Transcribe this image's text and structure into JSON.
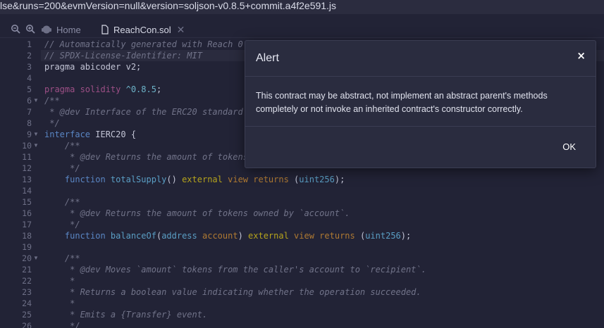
{
  "url_fragment": "lse&runs=200&evmVersion=null&version=soljson-v0.8.5+commit.a4f2e591.js",
  "toolbar": {
    "zoom_out_icon": "zoom-out-icon",
    "zoom_in_icon": "zoom-in-icon"
  },
  "tabs": [
    {
      "label": "Home",
      "icon": "remix-logo-icon",
      "active": false
    },
    {
      "label": "ReachCon.sol",
      "icon": "file-icon",
      "active": true,
      "close_icon": "close-icon"
    }
  ],
  "editor": {
    "line_numbers": [
      "1",
      "2",
      "3",
      "4",
      "5",
      "6",
      "7",
      "8",
      "9",
      "10",
      "11",
      "12",
      "13",
      "14",
      "15",
      "16",
      "17",
      "18",
      "19",
      "20",
      "21",
      "22",
      "23",
      "24",
      "25",
      "26"
    ],
    "fold_lines": [
      "6",
      "9",
      "10",
      "20"
    ],
    "line_1": "// Automatically generated with Reach 0",
    "line_2": "// SPDX-License-Identifier: MIT",
    "line_3": "pragma abicoder v2;",
    "line_5_a": "pragma solidity ",
    "line_5_b": "^0.8.5",
    "line_5_c": ";",
    "line_6": "/**",
    "line_7": " * @dev Interface of the ERC20 standard",
    "line_8": " */",
    "line_9_a": "interface",
    "line_9_b": " IERC20 {",
    "line_10": "    /**",
    "line_11": "     * @dev Returns the amount of tokens",
    "line_12": "     */",
    "line_13_a": "    function",
    "line_13_b": " totalSupply",
    "line_13_c": "()",
    "line_13_d": " external",
    "line_13_e": " view",
    "line_13_f": " returns",
    "line_13_g": " (",
    "line_13_h": "uint256",
    "line_13_i": ");",
    "line_15": "    /**",
    "line_16": "     * @dev Returns the amount of tokens owned by `account`.",
    "line_17": "     */",
    "line_18_a": "    function",
    "line_18_b": " balanceOf",
    "line_18_c": "(",
    "line_18_d": "address",
    "line_18_e": " account",
    "line_18_f": ")",
    "line_18_g": " external",
    "line_18_h": " view",
    "line_18_i": " returns",
    "line_18_j": " (",
    "line_18_k": "uint256",
    "line_18_l": ");",
    "line_20": "    /**",
    "line_21": "     * @dev Moves `amount` tokens from the caller's account to `recipient`.",
    "line_22": "     *",
    "line_23": "     * Returns a boolean value indicating whether the operation succeeded.",
    "line_24": "     *",
    "line_25": "     * Emits a {Transfer} event.",
    "line_26": "     */"
  },
  "alert": {
    "title": "Alert",
    "close_symbol": "×",
    "message": "This contract may be abstract, not implement an abstract parent's methods completely or not invoke an inherited contract's constructor correctly.",
    "ok_label": "OK"
  },
  "colors": {
    "background": "#222336",
    "modal_background": "#2a2c3f",
    "comment": "#717389",
    "keyword": "#5a86c4",
    "pragma_keyword": "#9d4f86"
  }
}
